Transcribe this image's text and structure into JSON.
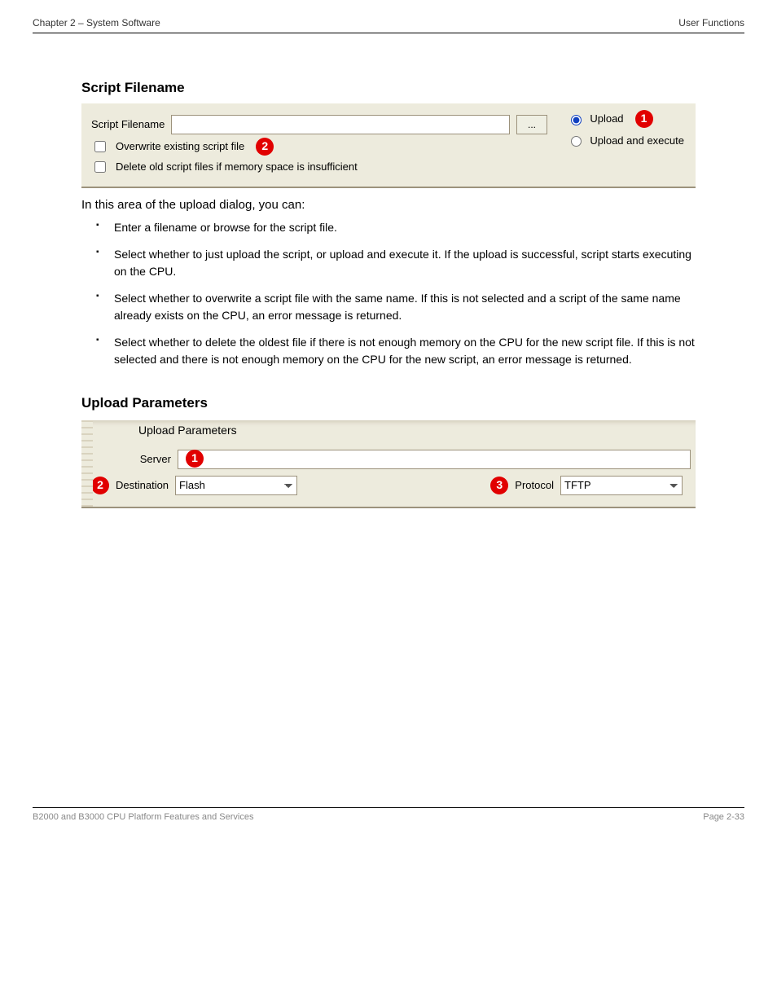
{
  "header": {
    "left": "Chapter 2 – System Software",
    "right": "User Functions"
  },
  "footer": {
    "left": "B2000 and B3000 CPU Platform Features and Services",
    "right": "Page 2-33"
  },
  "section1": {
    "title": "Script Filename",
    "panel": {
      "filename_label": "Script Filename",
      "filename_value": "",
      "browse_label": "...",
      "overwrite_label": "Overwrite existing script file",
      "delete_label": "Delete old script files if memory space is insufficient",
      "upload_label": "Upload",
      "upload_exec_label": "Upload and execute",
      "badge_upload": "1",
      "badge_overwrite": "2"
    },
    "instr": "In this area of the upload dialog, you can:",
    "bullets": [
      {
        "lead": "",
        "text": "Enter a filename or browse for the script file."
      },
      {
        "lead": "",
        "text": "Select whether to just upload the script, or upload and execute it. If the upload is successful, script starts executing on the CPU."
      },
      {
        "lead": "",
        "text": "Select whether to overwrite a script file with the same name. If this is not selected and a script of the same name already exists on the CPU, an error message is returned."
      },
      {
        "lead": "",
        "text": "Select whether to delete the oldest file if there is not enough memory on the CPU for the new script file. If this is not selected and there is not enough memory on the CPU for the new script, an error message is returned."
      }
    ]
  },
  "section2": {
    "title": "Upload Parameters",
    "panel": {
      "legend": "Upload Parameters",
      "server_label": "Server",
      "server_value": "",
      "dest_label": "Destination",
      "dest_value": "Flash",
      "proto_label": "Protocol",
      "proto_value": "TFTP",
      "badge_server": "1",
      "badge_dest": "2",
      "badge_proto": "3"
    }
  }
}
